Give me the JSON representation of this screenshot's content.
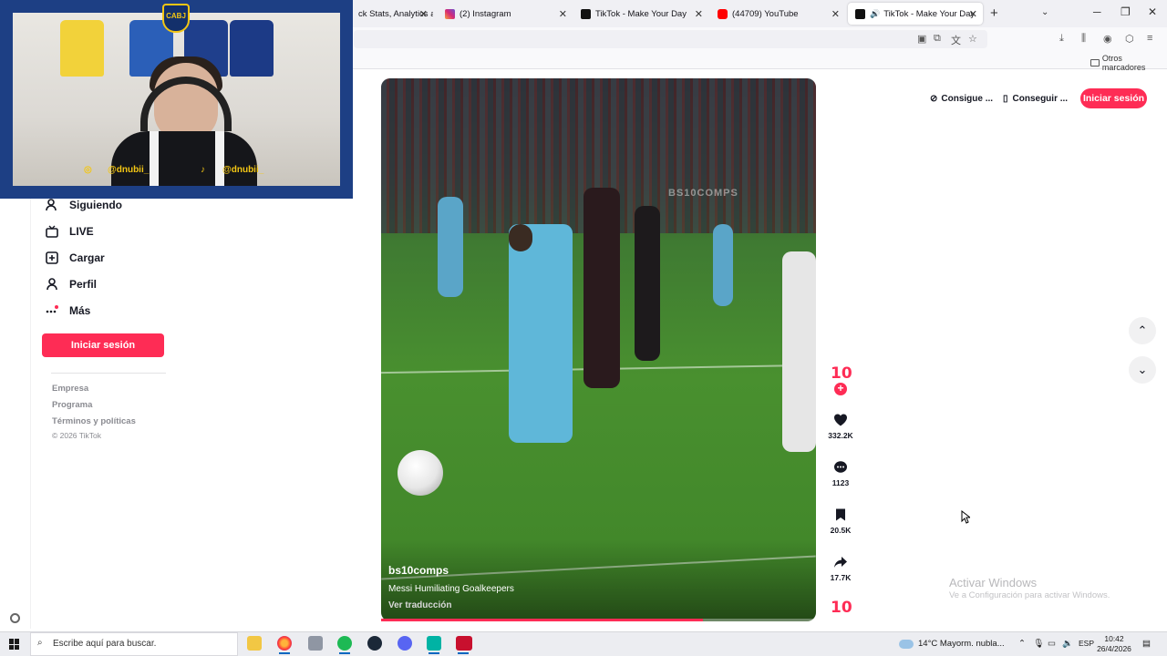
{
  "browser": {
    "tabs": [
      {
        "title": "ck Stats, Analytics and",
        "favicon": "analytics-favicon",
        "color": "#2c6ed5"
      },
      {
        "title": "(2) Instagram",
        "favicon": "instagram-favicon",
        "color": "#d62976"
      },
      {
        "title": "TikTok - Make Your Day",
        "favicon": "tiktok-favicon",
        "color": "#111111"
      },
      {
        "title": "(44709) YouTube",
        "favicon": "youtube-favicon",
        "color": "#ff0000"
      },
      {
        "title": "TikTok - Make Your Day",
        "favicon": "tiktok-favicon",
        "color": "#111111",
        "active": true,
        "audio": true
      }
    ],
    "bookmarks": {
      "other_folder": "Otros marcadores"
    }
  },
  "webcam": {
    "crest": "CABJ",
    "handle_instagram": "@dnubii_",
    "handle_tiktok": "@dnubii_"
  },
  "sidebar": {
    "items": [
      {
        "label": "Siguiendo",
        "icon": "following-icon"
      },
      {
        "label": "LIVE",
        "icon": "live-icon"
      },
      {
        "label": "Cargar",
        "icon": "upload-icon"
      },
      {
        "label": "Perfil",
        "icon": "profile-icon"
      },
      {
        "label": "Más",
        "icon": "more-icon"
      }
    ],
    "login_label": "Iniciar sesión",
    "footer_links": [
      "Empresa",
      "Programa",
      "Términos y políticas"
    ],
    "copyright": "© 2026 TikTok"
  },
  "header": {
    "coins_label": "Consigue ...",
    "app_label": "Conseguir ...",
    "login_label": "Iniciar sesión"
  },
  "video": {
    "watermark": "BS10COMPS",
    "author": "bs10comps",
    "description": "Messi Humiliating Goalkeepers",
    "translate": "Ver traducción",
    "progress": 0.74,
    "avatar_text": "10"
  },
  "actions": {
    "likes": "332.2K",
    "comments": "1123",
    "saves": "20.5K",
    "shares": "17.7K",
    "sound_avatar": "10"
  },
  "watermark_windows": {
    "line1": "Activar Windows",
    "line2": "Ve a Configuración para activar Windows."
  },
  "taskbar": {
    "search_placeholder": "Escribe aquí para buscar.",
    "weather": "14°C  Mayorm. nubla...",
    "language": "ESP",
    "time": "10:42",
    "date": "26/4/2026"
  },
  "colors": {
    "accent": "#fe2c55",
    "taskbar_accent": "#0067c0"
  }
}
